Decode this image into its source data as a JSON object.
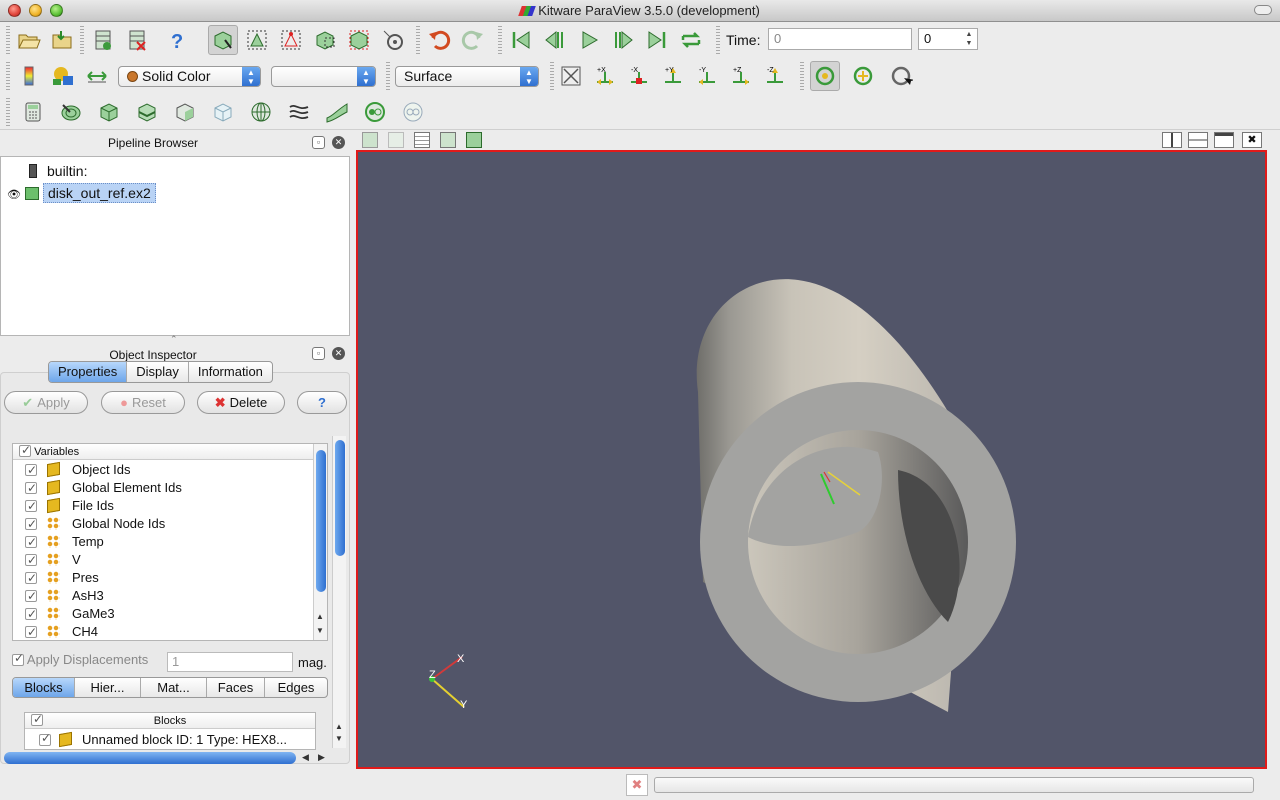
{
  "window": {
    "title": "Kitware ParaView 3.5.0 (development)"
  },
  "toolbar": {
    "color_by": "Solid Color",
    "component": "",
    "representation": "Surface",
    "time_label": "Time:",
    "time_value": "0",
    "time_step": "0",
    "camera_buttons": [
      "+X",
      "-X",
      "+Y",
      "-Y",
      "+Z",
      "-Z"
    ]
  },
  "pipeline": {
    "title": "Pipeline Browser",
    "items": [
      {
        "label": "builtin:",
        "icon": "server-icon"
      },
      {
        "label": "disk_out_ref.ex2",
        "icon": "reader-icon",
        "selected": true,
        "visible": true
      }
    ]
  },
  "inspector": {
    "title": "Object Inspector",
    "tabs": [
      "Properties",
      "Display",
      "Information"
    ],
    "active_tab": "Properties",
    "buttons": {
      "apply": "Apply",
      "reset": "Reset",
      "delete": "Delete",
      "help": "?"
    },
    "variables": {
      "header": "Variables",
      "items": [
        {
          "label": "Object Ids",
          "kind": "cell"
        },
        {
          "label": "Global Element Ids",
          "kind": "cell"
        },
        {
          "label": "File Ids",
          "kind": "cell"
        },
        {
          "label": "Global Node Ids",
          "kind": "point"
        },
        {
          "label": "Temp",
          "kind": "point"
        },
        {
          "label": "V",
          "kind": "point"
        },
        {
          "label": "Pres",
          "kind": "point"
        },
        {
          "label": "AsH3",
          "kind": "point"
        },
        {
          "label": "GaMe3",
          "kind": "point"
        },
        {
          "label": "CH4",
          "kind": "point"
        }
      ]
    },
    "displacements": {
      "label": "Apply Displacements",
      "value": "1",
      "suffix": "mag."
    },
    "block_tabs": [
      "Blocks",
      "Hier...",
      "Mat...",
      "Faces",
      "Edges"
    ],
    "active_block_tab": "Blocks",
    "blocks": {
      "header": "Blocks",
      "items": [
        "Unnamed block ID: 1 Type: HEX8..."
      ]
    }
  },
  "view": {
    "background": "#525569",
    "border": "#e01a1a",
    "axes_labels": {
      "x": "X",
      "y": "Y",
      "z": "Z"
    }
  },
  "colors": {
    "accent": "#2f6fd0",
    "selection": "#b9d3f5"
  }
}
